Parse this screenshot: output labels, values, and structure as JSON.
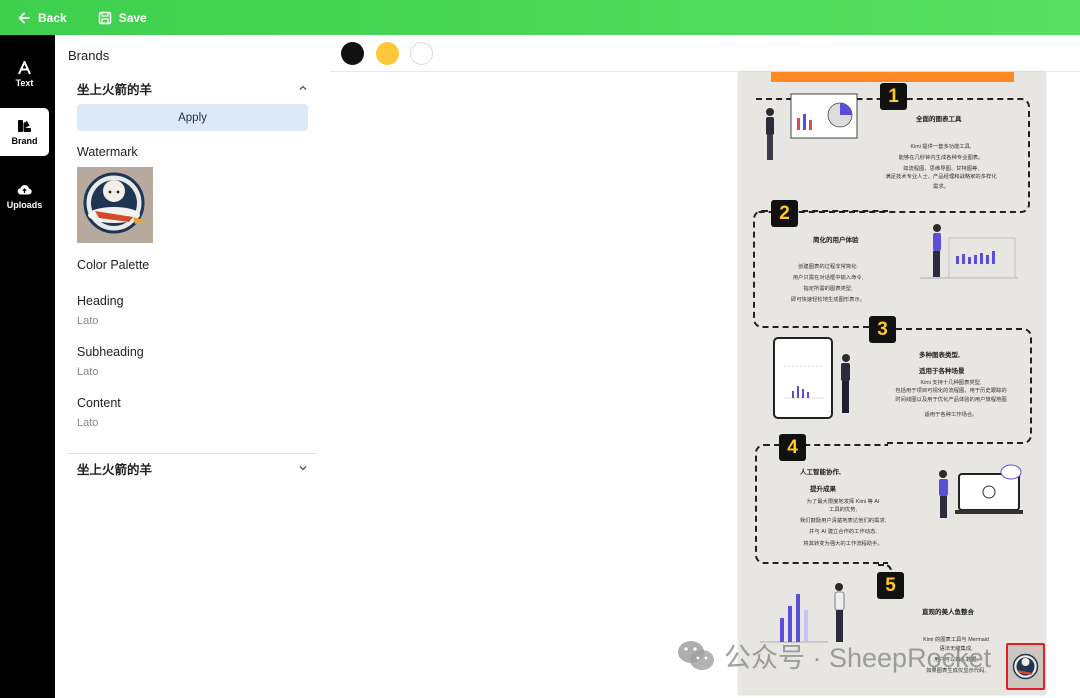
{
  "topbar": {
    "back_label": "Back",
    "save_label": "Save"
  },
  "rail": [
    {
      "label": "Text",
      "icon": "text-icon"
    },
    {
      "label": "Brand",
      "icon": "brand-icon"
    },
    {
      "label": "Uploads",
      "icon": "cloud-upload-icon"
    }
  ],
  "panel": {
    "title": "Brands",
    "brand_name": "坐上火箭的羊",
    "apply_label": "Apply",
    "watermark_label": "Watermark",
    "palette_label": "Color Palette",
    "heading_label": "Heading",
    "heading_font": "Lato",
    "subheading_label": "Subheading",
    "subheading_font": "Lato",
    "content_label": "Content",
    "content_font": "Lato",
    "second_brand_name": "坐上火箭的羊"
  },
  "palette": [
    "#111111",
    "#ffc83a",
    "#ffffff"
  ],
  "canvas": {
    "sections": [
      {
        "num": "1",
        "title": "全面的图表工具",
        "lines": [
          "Kimi 提供一套多功能工具,",
          "能够在几秒钟内生成各种专业图表。",
          "如流程图、思维导图、甘特图等,",
          "满足技术专业人士、产品经理和战略家的多样化",
          "需求。"
        ]
      },
      {
        "num": "2",
        "title": "简化的用户体验",
        "lines": [
          "创建图表的过程非常简化:",
          "用户只需在对话框中输入命令,",
          "指定所需的图表类型,",
          "即可快速轻松地生成图形表示。"
        ]
      },
      {
        "num": "3",
        "title": "多种图表类型,",
        "title2": "适用于各种场景",
        "lines": [
          "Kimi 支持十几种图表类型,",
          "包括用于项目可视化的流程图、用于历史跟踪的",
          "时间线图以及用于优化产品体验的用户旅程地图",
          "适用于各种工作场合。"
        ]
      },
      {
        "num": "4",
        "title": "人工智能协作,",
        "title2": "提升成果",
        "lines": [
          "为了最大限度地发挥 Kimi 等 AI",
          "工具的优势,",
          "我们鼓励用户清楚地表达他们的需求,",
          "并与 AI 建立合作的工作动态,",
          "将其转变为强大的工作流程助手。"
        ]
      },
      {
        "num": "5",
        "title": "直观的美人鱼整合",
        "lines": [
          "Kimi 的图表工具与 Mermaid",
          "语法无缝集成,",
          "用户可以输入数据,",
          "如果图表生成仅显示代码,"
        ]
      }
    ]
  },
  "overlay": {
    "wechat_text": "公众号 · SheepRocket"
  }
}
